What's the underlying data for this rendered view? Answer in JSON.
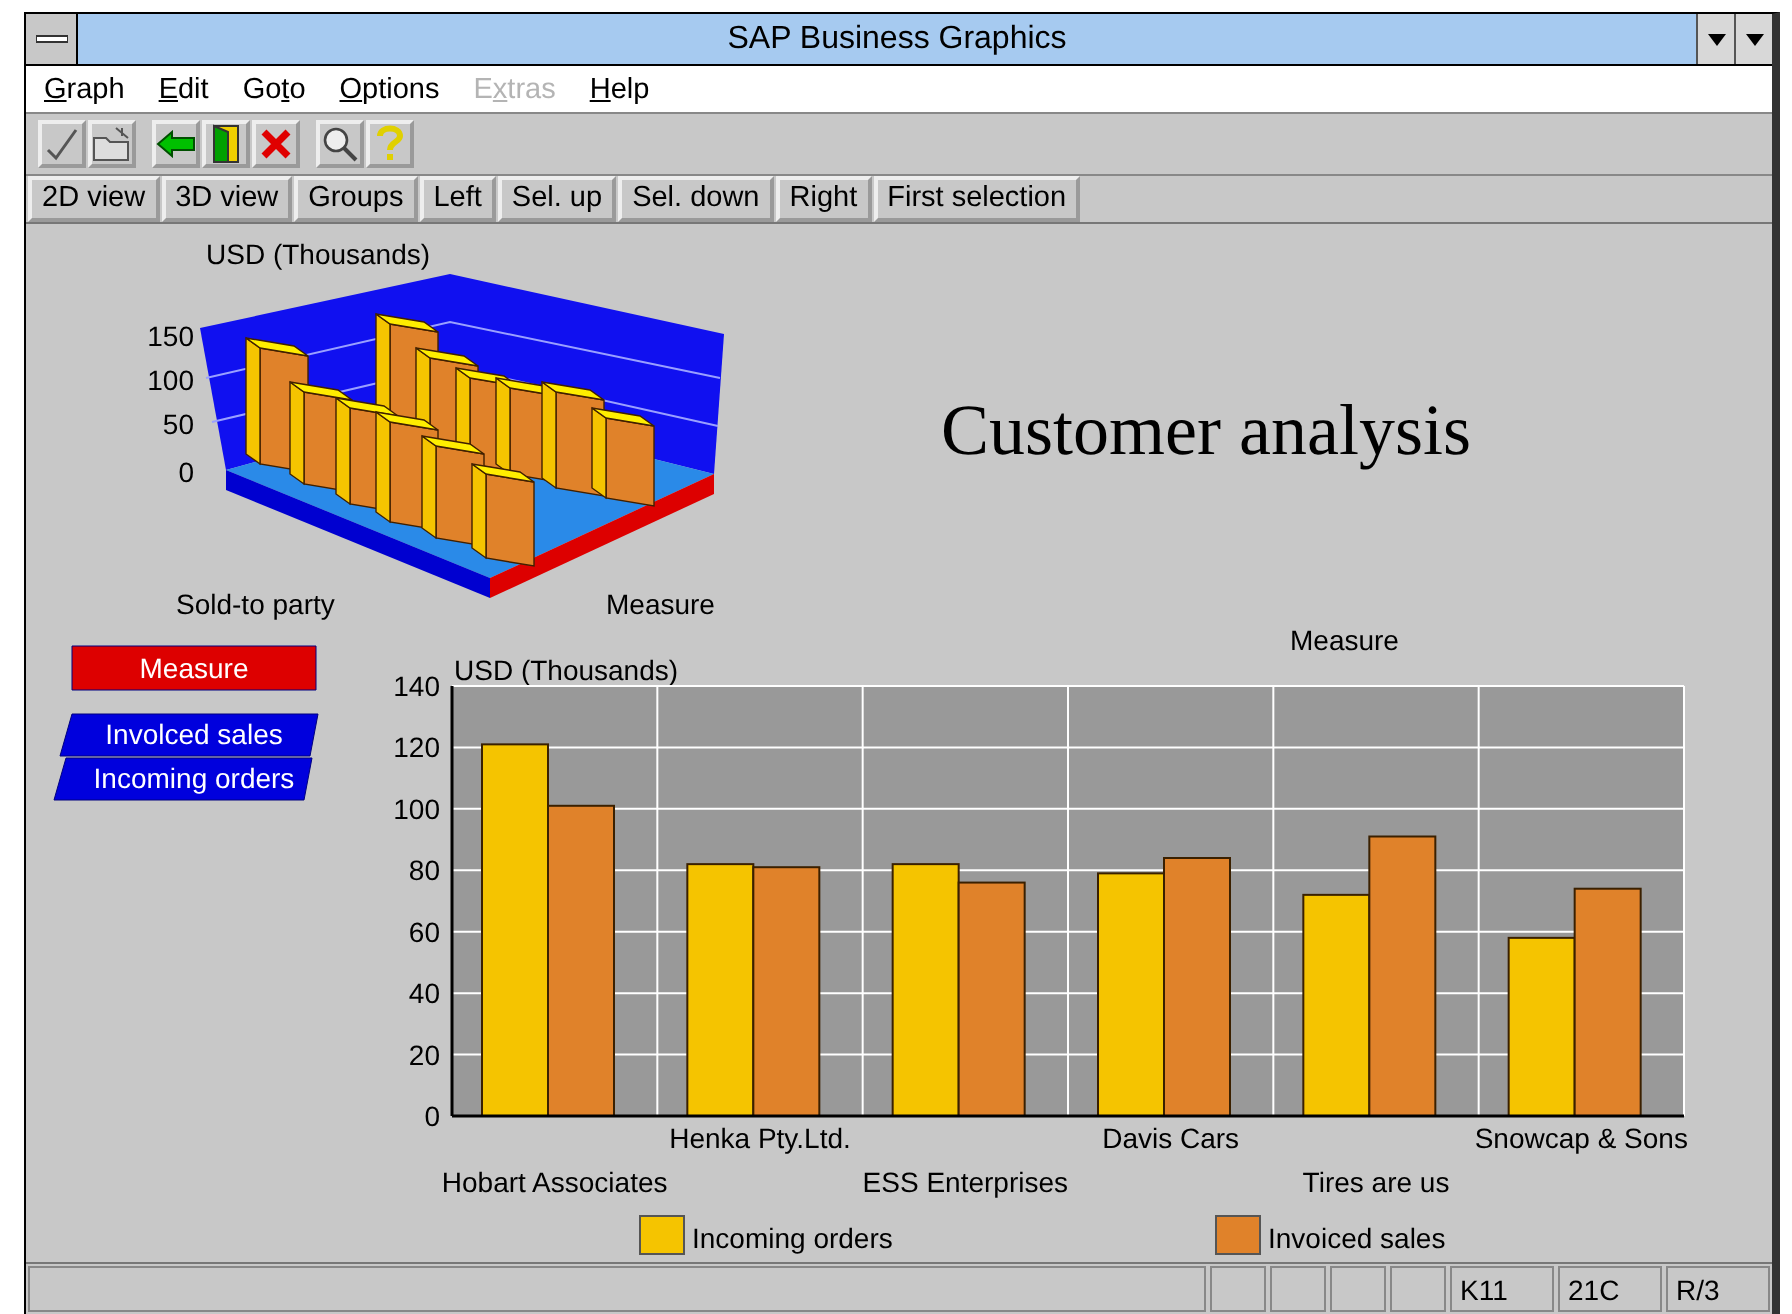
{
  "window": {
    "title": "SAP Business Graphics"
  },
  "menu": [
    {
      "key": "G",
      "after": "raph",
      "disabled": false
    },
    {
      "key": "E",
      "after": "dit",
      "disabled": false
    },
    {
      "before": "Go",
      "key": "t",
      "after": "o",
      "disabled": false
    },
    {
      "key": "O",
      "after": "ptions",
      "disabled": false
    },
    {
      "before": "E",
      "key": "x",
      "after": "tras",
      "disabled": true
    },
    {
      "key": "H",
      "after": "elp",
      "disabled": false
    }
  ],
  "view_buttons": [
    "2D view",
    "3D view",
    "Groups",
    "Left",
    "Sel. up",
    "Sel. down",
    "Right",
    "First selection"
  ],
  "chart_3d": {
    "ylabel": "USD (Thousands)",
    "yticks": [
      "150",
      "100",
      "50",
      "0"
    ],
    "xlabel": "Sold-to party",
    "zlabel": "Measure"
  },
  "title": "Customer analysis",
  "legend_panel": [
    {
      "label": "Measure",
      "kind": "header"
    },
    {
      "label": "Involced sales",
      "kind": "series"
    },
    {
      "label": "Incoming orders",
      "kind": "series"
    }
  ],
  "chart": {
    "chart_data": {
      "type": "bar",
      "title": "Measure",
      "ylabel": "USD (Thousands)",
      "categories": [
        "Hobart Associates",
        "Henka Pty.Ltd.",
        "ESS Enterprises",
        "Davis Cars",
        "Tires are us",
        "Snowcap & Sons"
      ],
      "series": [
        {
          "name": "Incoming orders",
          "color": "#f5c400",
          "values": [
            121,
            82,
            82,
            79,
            72,
            58
          ]
        },
        {
          "name": "Invoiced sales",
          "color": "#e0822a",
          "values": [
            101,
            81,
            76,
            84,
            91,
            74
          ]
        }
      ],
      "grid": true,
      "legend": true,
      "ylim": [
        0,
        140
      ],
      "yticks": [
        0,
        20,
        40,
        60,
        80,
        100,
        120,
        140
      ]
    }
  },
  "status_bar": {
    "fields": [
      "K11",
      "21C",
      "R/3"
    ]
  }
}
